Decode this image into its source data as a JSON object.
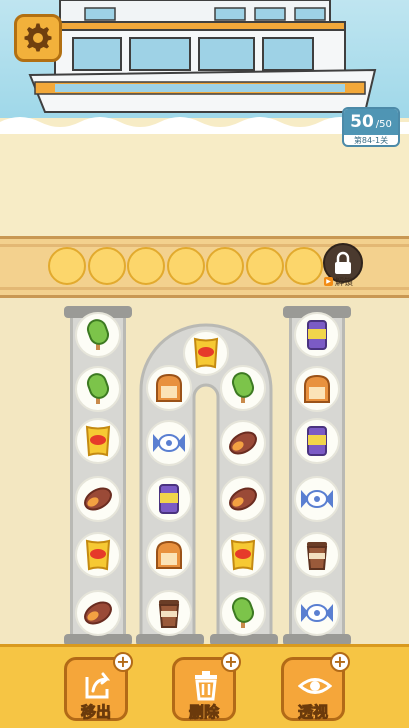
{
  "header": {
    "counter_current": "50",
    "counter_sep": " / ",
    "counter_total": "50",
    "level_label": "第84-1关"
  },
  "slot_bar": {
    "slot_count": 7,
    "unlock_label": "解锁"
  },
  "columns": [
    {
      "name": "left",
      "items": [
        "popsicle",
        "popsicle",
        "chips",
        "sweet-potato",
        "chips",
        "sweet-potato"
      ]
    },
    {
      "name": "arch-left",
      "items": [
        "chips",
        "bread",
        "candy",
        "can",
        "bread",
        "cup"
      ]
    },
    {
      "name": "arch-right",
      "items": [
        "popsicle",
        "sweet-potato",
        "sweet-potato",
        "chips",
        "popsicle"
      ]
    },
    {
      "name": "right",
      "items": [
        "can",
        "bread",
        "can",
        "candy",
        "cup",
        "candy"
      ]
    }
  ],
  "tools": {
    "move_label": "移出",
    "remove_label": "删除",
    "reveal_label": "透视"
  },
  "colors": {
    "accent": "#f5a63a",
    "bottom_bar": "#f6c544",
    "slot": "#fcd66b"
  }
}
